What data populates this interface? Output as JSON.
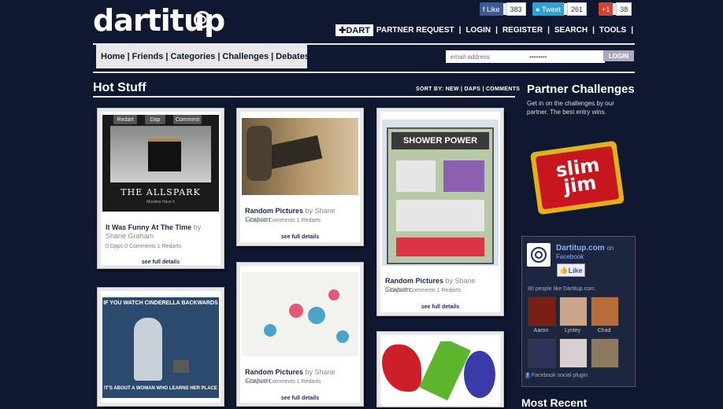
{
  "site": {
    "logo": "dartitup"
  },
  "social": {
    "like_label": "Like",
    "like_count": "383",
    "tweet_label": "Tweet",
    "tweet_count": "261",
    "plus_label": "+1",
    "plus_count": "38"
  },
  "topnav": {
    "dart": "DART",
    "items": [
      "PARTNER REQUEST",
      "LOGIN",
      "REGISTER",
      "SEARCH",
      "TOOLS"
    ]
  },
  "menu": {
    "items": [
      "Home",
      "Friends",
      "Categories",
      "Challenges",
      "Debates"
    ]
  },
  "login": {
    "email_placeholder": "email address",
    "password_value": "••••••••",
    "button": "LOGIN"
  },
  "hot": {
    "title": "Hot Stuff",
    "sort": "SORT BY: NEW | DAPS | COMMENTS",
    "cards": [
      {
        "title": "It Was Funny At The Time",
        "by": "by Shane Graham",
        "stats": "0 Daps   0 Comments   1 Redarts",
        "details": "see full details",
        "caption": "THE ALLSPARK",
        "subcaption": "Muslims Have It",
        "actions": [
          "Redart",
          "Dap",
          "Comment"
        ]
      },
      {
        "title": "Random Pictures",
        "by": "by Shane Graham",
        "stats": "1 Daps   0 Comments   1 Redarts",
        "details": "see full details"
      },
      {
        "title": "Random Pictures",
        "by": "by Shane Graham",
        "stats": "0 Daps   0 Comments   1 Redarts",
        "details": "see full details",
        "caption": "SHOWER POWER"
      },
      {
        "caption_top": "IF YOU WATCH CINDERELLA BACKWARDS",
        "caption_bottom": "IT'S ABOUT A WOMAN WHO LEARNS HER PLACE"
      },
      {
        "title": "Random Pictures",
        "by": "by Shane Graham",
        "stats": "0 Daps   0 Comments   1 Redarts",
        "details": "see full details"
      },
      {}
    ]
  },
  "sidebar": {
    "title": "Partner Challenges",
    "text": "Get in on the challenges by our partner. The best entry wins.",
    "brand": "slim jim",
    "fb": {
      "name": "Dartitup.com",
      "on": "on",
      "platform": "Facebook",
      "like": "Like",
      "count": "80 people like Dartitup.com.",
      "people": [
        "Aaron",
        "Lynley",
        "Chad",
        "",
        "",
        ""
      ],
      "plugin": "Facebook social plugin"
    },
    "most_recent": "Most Recent"
  },
  "colors": {
    "bg": "#0f1830",
    "accent": "#e6e6e6",
    "link": "#1a2a50"
  }
}
